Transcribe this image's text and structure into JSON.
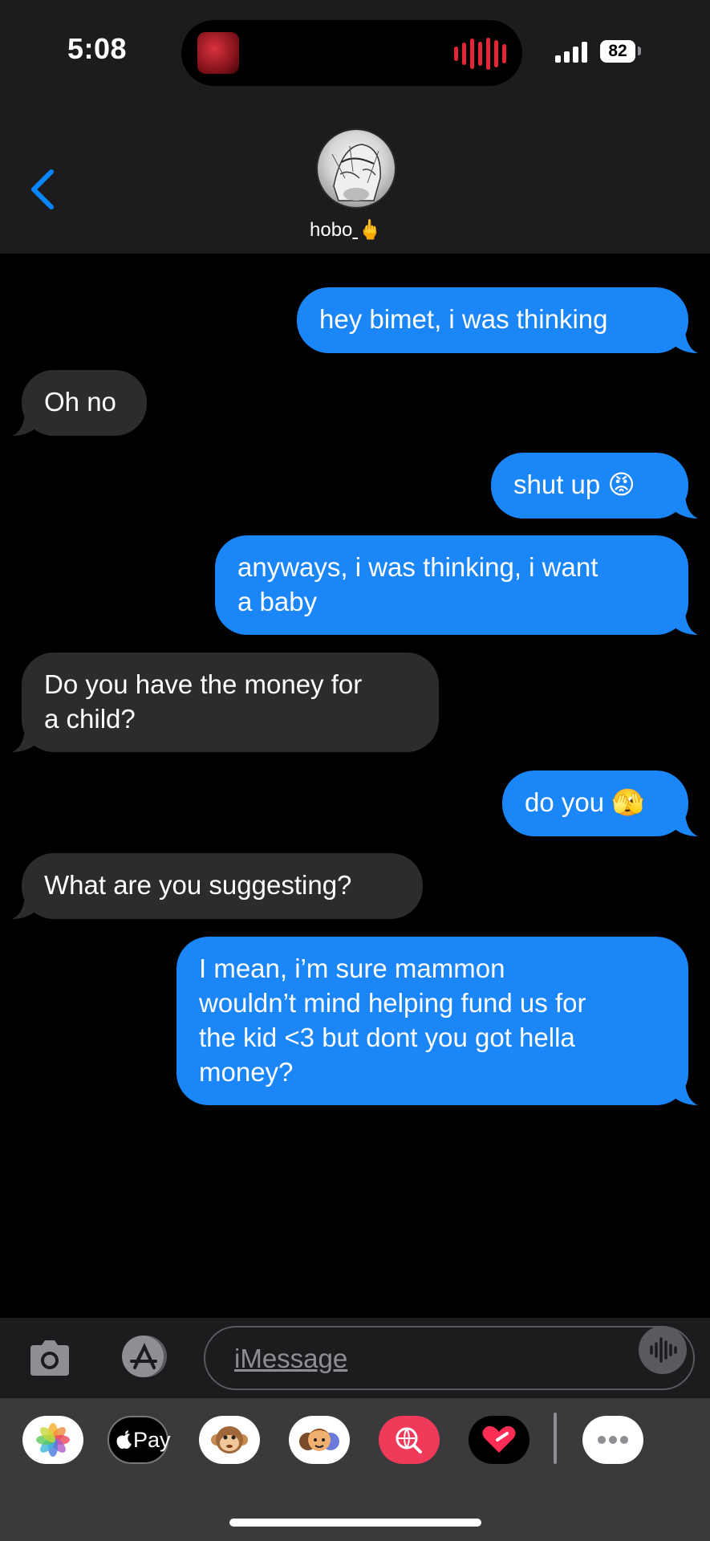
{
  "status_bar": {
    "time": "5:08",
    "battery": "82"
  },
  "contact": {
    "name": "hobo",
    "emoji": "🖕"
  },
  "messages": [
    {
      "side": "sent",
      "text": "hey bimet, i was thinking"
    },
    {
      "side": "recv",
      "text": "Oh no"
    },
    {
      "side": "sent",
      "text": "shut up 😡"
    },
    {
      "side": "sent",
      "text": "anyways, i was thinking, i want\na baby"
    },
    {
      "side": "recv",
      "text": "Do you have the money for\na child?"
    },
    {
      "side": "sent",
      "text": "do you 🫣"
    },
    {
      "side": "recv",
      "text": "What are you suggesting?"
    },
    {
      "side": "sent",
      "text": "I mean, i’m sure mammon\nwouldn’t mind helping fund us for\nthe kid <3 but dont you got hella\nmoney?"
    }
  ],
  "composer": {
    "placeholder": "iMessage"
  },
  "apps": {
    "apple_pay_label": "Pay"
  },
  "colors": {
    "sent": "#1b86f8",
    "received": "#2c2c2e",
    "accent": "#0a84ff"
  }
}
